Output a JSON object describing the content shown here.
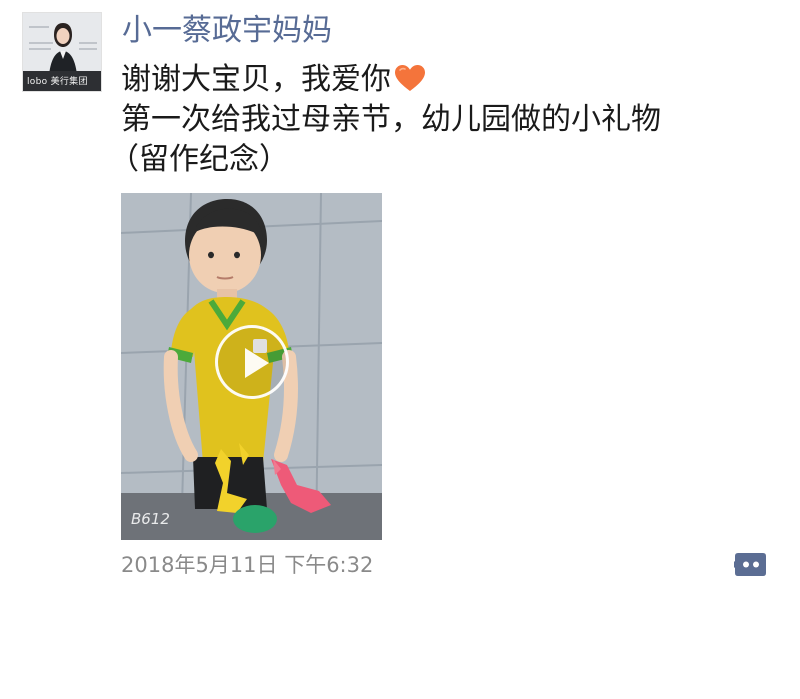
{
  "post": {
    "author_name": "小一蔡政宇妈妈",
    "text_line1": "谢谢大宝贝，我爱你",
    "text_line2": "第一次给我过母亲节，幼儿园做的小礼物",
    "text_line3": "（留作纪念）",
    "emoji": "orange-heart",
    "timestamp": "2018年5月11日 下午6:32",
    "video_watermark": "B612"
  },
  "avatar": {
    "brand_text": "lobo 美行集团"
  },
  "colors": {
    "nickname": "#576b95",
    "text": "#1a1a1a",
    "timestamp": "#8a8a8a",
    "heart": "#f4743b",
    "comment_button": "#5b6d93"
  },
  "icons": {
    "play": "play-icon",
    "comment": "comment-icon",
    "heart": "heart-emoji-icon"
  }
}
